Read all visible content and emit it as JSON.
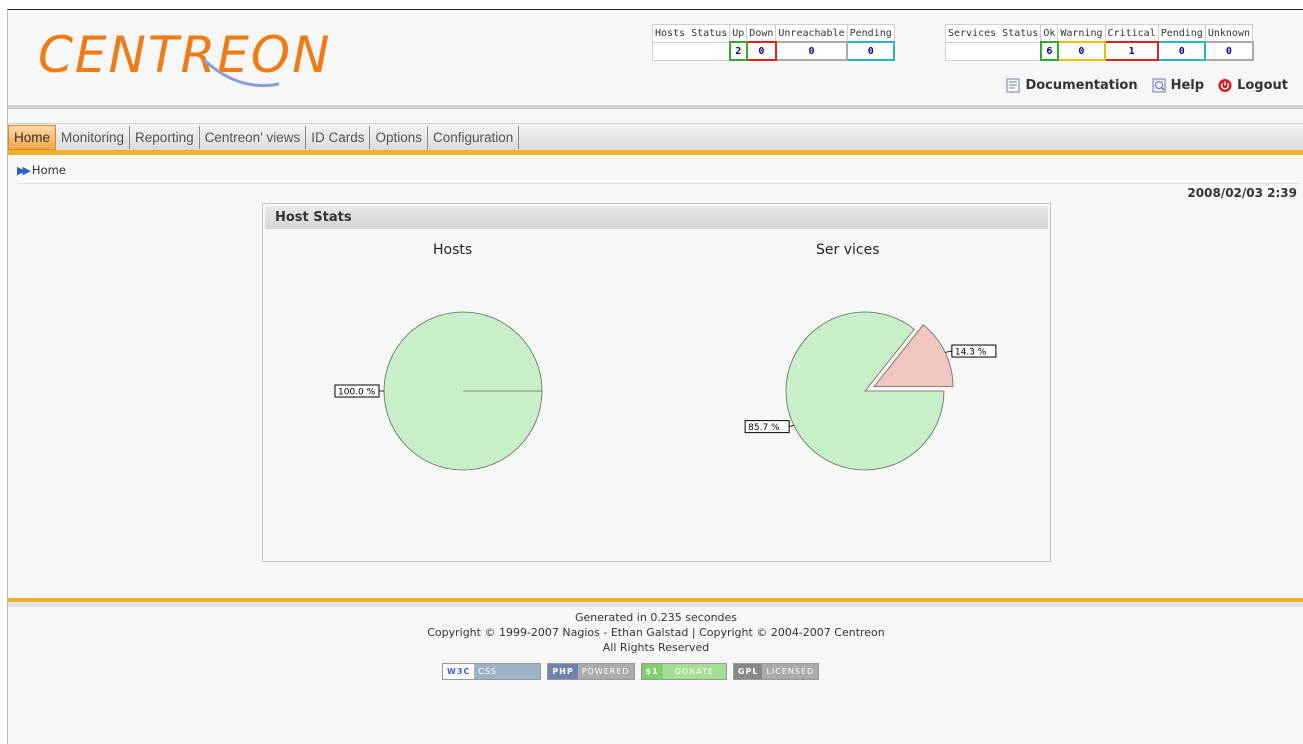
{
  "header": {
    "logo_text": "CENTREON",
    "hosts_status": {
      "headers": [
        "Hosts Status",
        "Up",
        "Down",
        "Unreachable",
        "Pending"
      ],
      "values": [
        "",
        "2",
        "0",
        "0",
        "0"
      ]
    },
    "services_status": {
      "headers": [
        "Services Status",
        "Ok",
        "Warning",
        "Critical",
        "Pending",
        "Unknown"
      ],
      "values": [
        "",
        "6",
        "0",
        "1",
        "0",
        "0"
      ]
    },
    "links": {
      "documentation": "Documentation",
      "help": "Help",
      "logout": "Logout"
    }
  },
  "menu": {
    "items": [
      "Home",
      "Monitoring",
      "Reporting",
      "Centreon' views",
      "ID Cards",
      "Options",
      "Configuration"
    ]
  },
  "breadcrumb": "Home",
  "date": "2008/02/03 2:39",
  "panel": {
    "title": "Host Stats",
    "hosts_title": "Hosts",
    "services_title": "Ser vices"
  },
  "chart_data": [
    {
      "type": "pie",
      "title": "Hosts",
      "labels": [
        "100.0 %"
      ],
      "values": [
        100.0
      ],
      "colors": [
        "#c8f0c8"
      ]
    },
    {
      "type": "pie",
      "title": "Ser vices",
      "labels": [
        "85.7 %",
        "14.3 %"
      ],
      "values": [
        85.7,
        14.3
      ],
      "colors": [
        "#c8f0c8",
        "#f2c6c0"
      ]
    }
  ],
  "footer": {
    "generated": "Generated in 0.235 secondes",
    "copyright": "Copyright © 1999-2007 Nagios - Ethan Galstad | Copyright © 2004-2007 Centreon",
    "rights": "All Rights Reserved",
    "badges": [
      {
        "left": "W3C",
        "right": "CSS"
      },
      {
        "left": "PHP",
        "right": "POWERED"
      },
      {
        "left": "$1",
        "right": "DONATE"
      },
      {
        "left": "GPL",
        "right": "LICENSED"
      }
    ]
  },
  "colors": {
    "accent": "#f07b16",
    "menu_underline": "#f2b02a",
    "ok_green": "#c8f0c8",
    "critical_pink": "#f2c6c0"
  }
}
